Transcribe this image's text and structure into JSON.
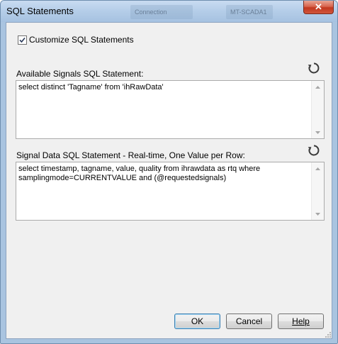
{
  "window": {
    "title": "SQL Statements",
    "close_glyph": "✕",
    "background_tabs": [
      "Connection",
      "MT-SCADA1"
    ]
  },
  "customize": {
    "label": "Customize SQL Statements",
    "checked": true
  },
  "available": {
    "label": "Available Signals SQL Statement:",
    "statement": "select distinct 'Tagname' from 'ihRawData'",
    "reset_icon": "reset-icon"
  },
  "signal_data": {
    "label": "Signal Data SQL Statement - Real-time, One Value per Row:",
    "statement": "select timestamp, tagname, value, quality from ihrawdata as rtq where\nsamplingmode=CURRENTVALUE and (@requestedsignals)",
    "reset_icon": "reset-icon"
  },
  "buttons": {
    "ok": "OK",
    "cancel": "Cancel",
    "help": "Help"
  }
}
